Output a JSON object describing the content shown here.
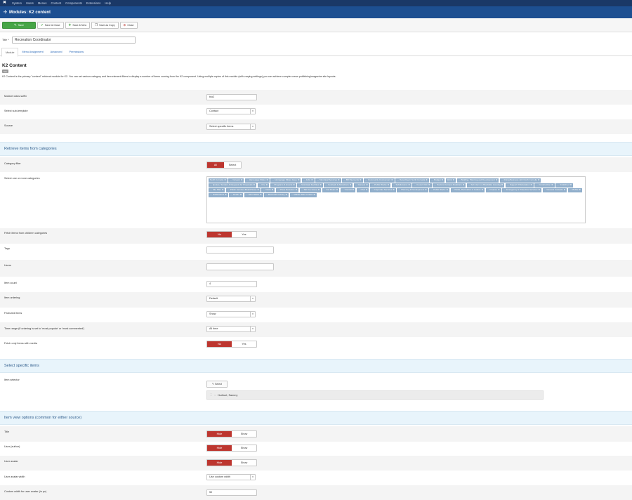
{
  "nav": {
    "items": [
      {
        "label": "System"
      },
      {
        "label": "Users"
      },
      {
        "label": "Menus"
      },
      {
        "label": "Content"
      },
      {
        "label": "Components"
      },
      {
        "label": "Extensions"
      },
      {
        "label": "Help"
      }
    ]
  },
  "header": {
    "title": "Modules: K2 content"
  },
  "toolbar": {
    "save": "Save",
    "save_close": "Save & Close",
    "save_new": "Save & New",
    "save_copy": "Save as Copy",
    "close": "Close"
  },
  "title_field": {
    "label": "Title *",
    "value": "Recreation Coordinator"
  },
  "tabs": [
    {
      "label": "Module"
    },
    {
      "label": "Menu Assignment"
    },
    {
      "label": "Advanced"
    },
    {
      "label": "Permissions"
    }
  ],
  "module": {
    "title": "K2 Content",
    "badge": "Site",
    "description": "K2 Content is the primary \"content\" retrieval module for K2. You can set various category and item element filters to display a number of items coming from the K2 component. Using multiple copies of this module (with varying settings) you can achieve complex news publishing/magazine site layouts."
  },
  "fields": {
    "module_class_suffix": {
      "label": "Module class suffix",
      "value": "bio2"
    },
    "sub_template": {
      "label": "Select sub-template",
      "value": "Contact"
    },
    "source": {
      "label": "Source",
      "value": "Select specific items"
    }
  },
  "sections": {
    "retrieve": "Retrieve items from categories",
    "specific": "Select specific items",
    "view_options": "Item view options (common for either source)"
  },
  "retrieve": {
    "category_filter": {
      "label": "Category filter",
      "all": "All",
      "select": "Select"
    },
    "categories_label": "Select one or more categories",
    "categories": [
      "North Cornelia",
      "— Careers",
      "— Homepage Slides",
      "— Homepage Slides Issue",
      "— Jobs",
      "— Municipal Services",
      "— Bill Payments",
      "— Community Involvement",
      "— Recycling in North Cornelia",
      "— Budget",
      "Work",
      "— Building, Planning and Development",
      "— Doing Business with North Cornelia",
      "— Quotes, Tenders & Requests for Proposals",
      "— Fire",
      "— Programs & Events",
      "— Municipal Facilities",
      "— Festivals & Attractions",
      "— Careers",
      "— Public Works",
      "— Subdivisions",
      "— Council Info",
      "— Tourism Campus Relations",
      "— Sub Hero or Affordable Housing",
      "— Support Of Education",
      "— Construction",
      "— Undefined",
      "— Site Plan",
      "— Public Services Board News",
      "— News",
      "— Press Releases",
      "— Tell You Home",
      "— Get Boats",
      "— Council",
      "— Chef",
      "— Corporate Services",
      "— Planning & Development",
      "— Public Works",
      "— Parks, Recreation & Culture",
      "— Finance",
      "— Emergency & Protective Services",
      "— General Contacts",
      "— Mobile",
      "— Notifications",
      "— Roads",
      "— Hand Wash",
      "— Bookmark Library",
      "— Mobile Web Contact"
    ],
    "fetch_children": {
      "label": "Fetch items from children categories",
      "no": "No",
      "yes": "Yes"
    },
    "tags": {
      "label": "Tags",
      "value": ""
    },
    "users": {
      "label": "Users",
      "value": ""
    },
    "item_count": {
      "label": "Item count",
      "value": "4"
    },
    "item_ordering": {
      "label": "Item ordering",
      "value": "Default"
    },
    "featured_items": {
      "label": "Featured items",
      "value": "Show"
    },
    "time_range": {
      "label": "Time range (if ordering is set to 'most popular' or 'most commented')",
      "value": "All time"
    },
    "fetch_media": {
      "label": "Fetch only items with media",
      "no": "No",
      "yes": "Yes"
    }
  },
  "specific": {
    "item_selector": {
      "label": "Item selector",
      "button": "Select"
    },
    "selected_item": "Hurlburt, Sammy"
  },
  "view": {
    "title": {
      "label": "Title",
      "hide": "Hide",
      "show": "Show"
    },
    "user_author": {
      "label": "User (author)",
      "hide": "Hide",
      "show": "Show"
    },
    "user_avatar": {
      "label": "User avatar",
      "hide": "Hide",
      "show": "Show"
    },
    "avatar_width": {
      "label": "User avatar width",
      "value": "Use custom width"
    },
    "custom_width": {
      "label": "Custom width for user avatar (in px)",
      "value": "50"
    }
  }
}
